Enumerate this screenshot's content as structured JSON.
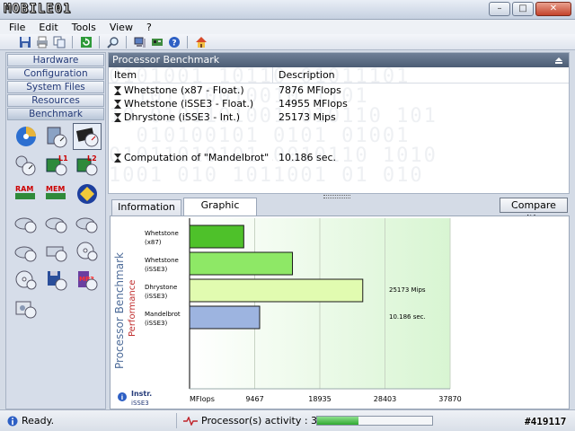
{
  "app": {
    "logo_text": "MOBILE01"
  },
  "window_buttons": {
    "minimize": "–",
    "maximize": "□",
    "close": "✕"
  },
  "menu": [
    "File",
    "Edit",
    "Tools",
    "View",
    "?"
  ],
  "nav": [
    "Hardware",
    "Configuration",
    "System Files",
    "Resources",
    "Benchmark"
  ],
  "icon_labels": {
    "l1": "L1",
    "l2": "L2",
    "ram": "RAM",
    "mem": "MEM",
    "mp3": "MP3"
  },
  "panel": {
    "title": "Processor Benchmark",
    "col_item": "Item",
    "col_desc": "Description",
    "rows": [
      {
        "item": "Whetstone (x87 - Float.)",
        "desc": "7876 MFlops"
      },
      {
        "item": "Whetstone (iSSE3 - Float.)",
        "desc": "14955 MFlops"
      },
      {
        "item": "Dhrystone (iSSE3 - Int.)",
        "desc": "25173 Mips"
      },
      {
        "item": "Computation of \"Mandelbrot\" ...",
        "desc": "10.186 sec."
      }
    ],
    "bg_digits": "0101001 10110 01011101\n  1011 0010010 1101\n10 0101101001 010110 101\n  010100101 0101 01001\n01011010101 0010110 1010\n1001 010 1011001 01 010"
  },
  "tabs": {
    "information": "Information",
    "graphic": "Graphic",
    "compare": "Compare with..."
  },
  "chart_data": {
    "type": "bar",
    "orientation": "horizontal",
    "title": "Processor Benchmark",
    "subtitle": "Performance",
    "legend_label": "Instr.",
    "legend_sub": "iSSE3",
    "categories": [
      {
        "line1": "Whetstone",
        "line2": "(x87)"
      },
      {
        "line1": "Whetstone",
        "line2": "(iSSE3)"
      },
      {
        "line1": "Dhrystone",
        "line2": "(iSSE3)"
      },
      {
        "line1": "Mandelbrot",
        "line2": "(iSSE3)"
      }
    ],
    "values": [
      7876,
      14955,
      25173,
      10186
    ],
    "value_labels": [
      "",
      "",
      "25173 Mips",
      "10.186 sec."
    ],
    "bar_colors": [
      "#4ec12a",
      "#8ee866",
      "#e1fbb0",
      "#9db4e0"
    ],
    "xlabel": "MFlops",
    "ticks": [
      0,
      9467,
      18935,
      28403,
      37870
    ],
    "tick_labels": [
      "MFlops",
      "9467",
      "18935",
      "28403",
      "37870"
    ],
    "xlim": [
      0,
      37870
    ]
  },
  "status": {
    "ready": "Ready.",
    "activity": "Processor(s) activity : 36%",
    "activity_pct": 36,
    "watermark": "#419117"
  }
}
